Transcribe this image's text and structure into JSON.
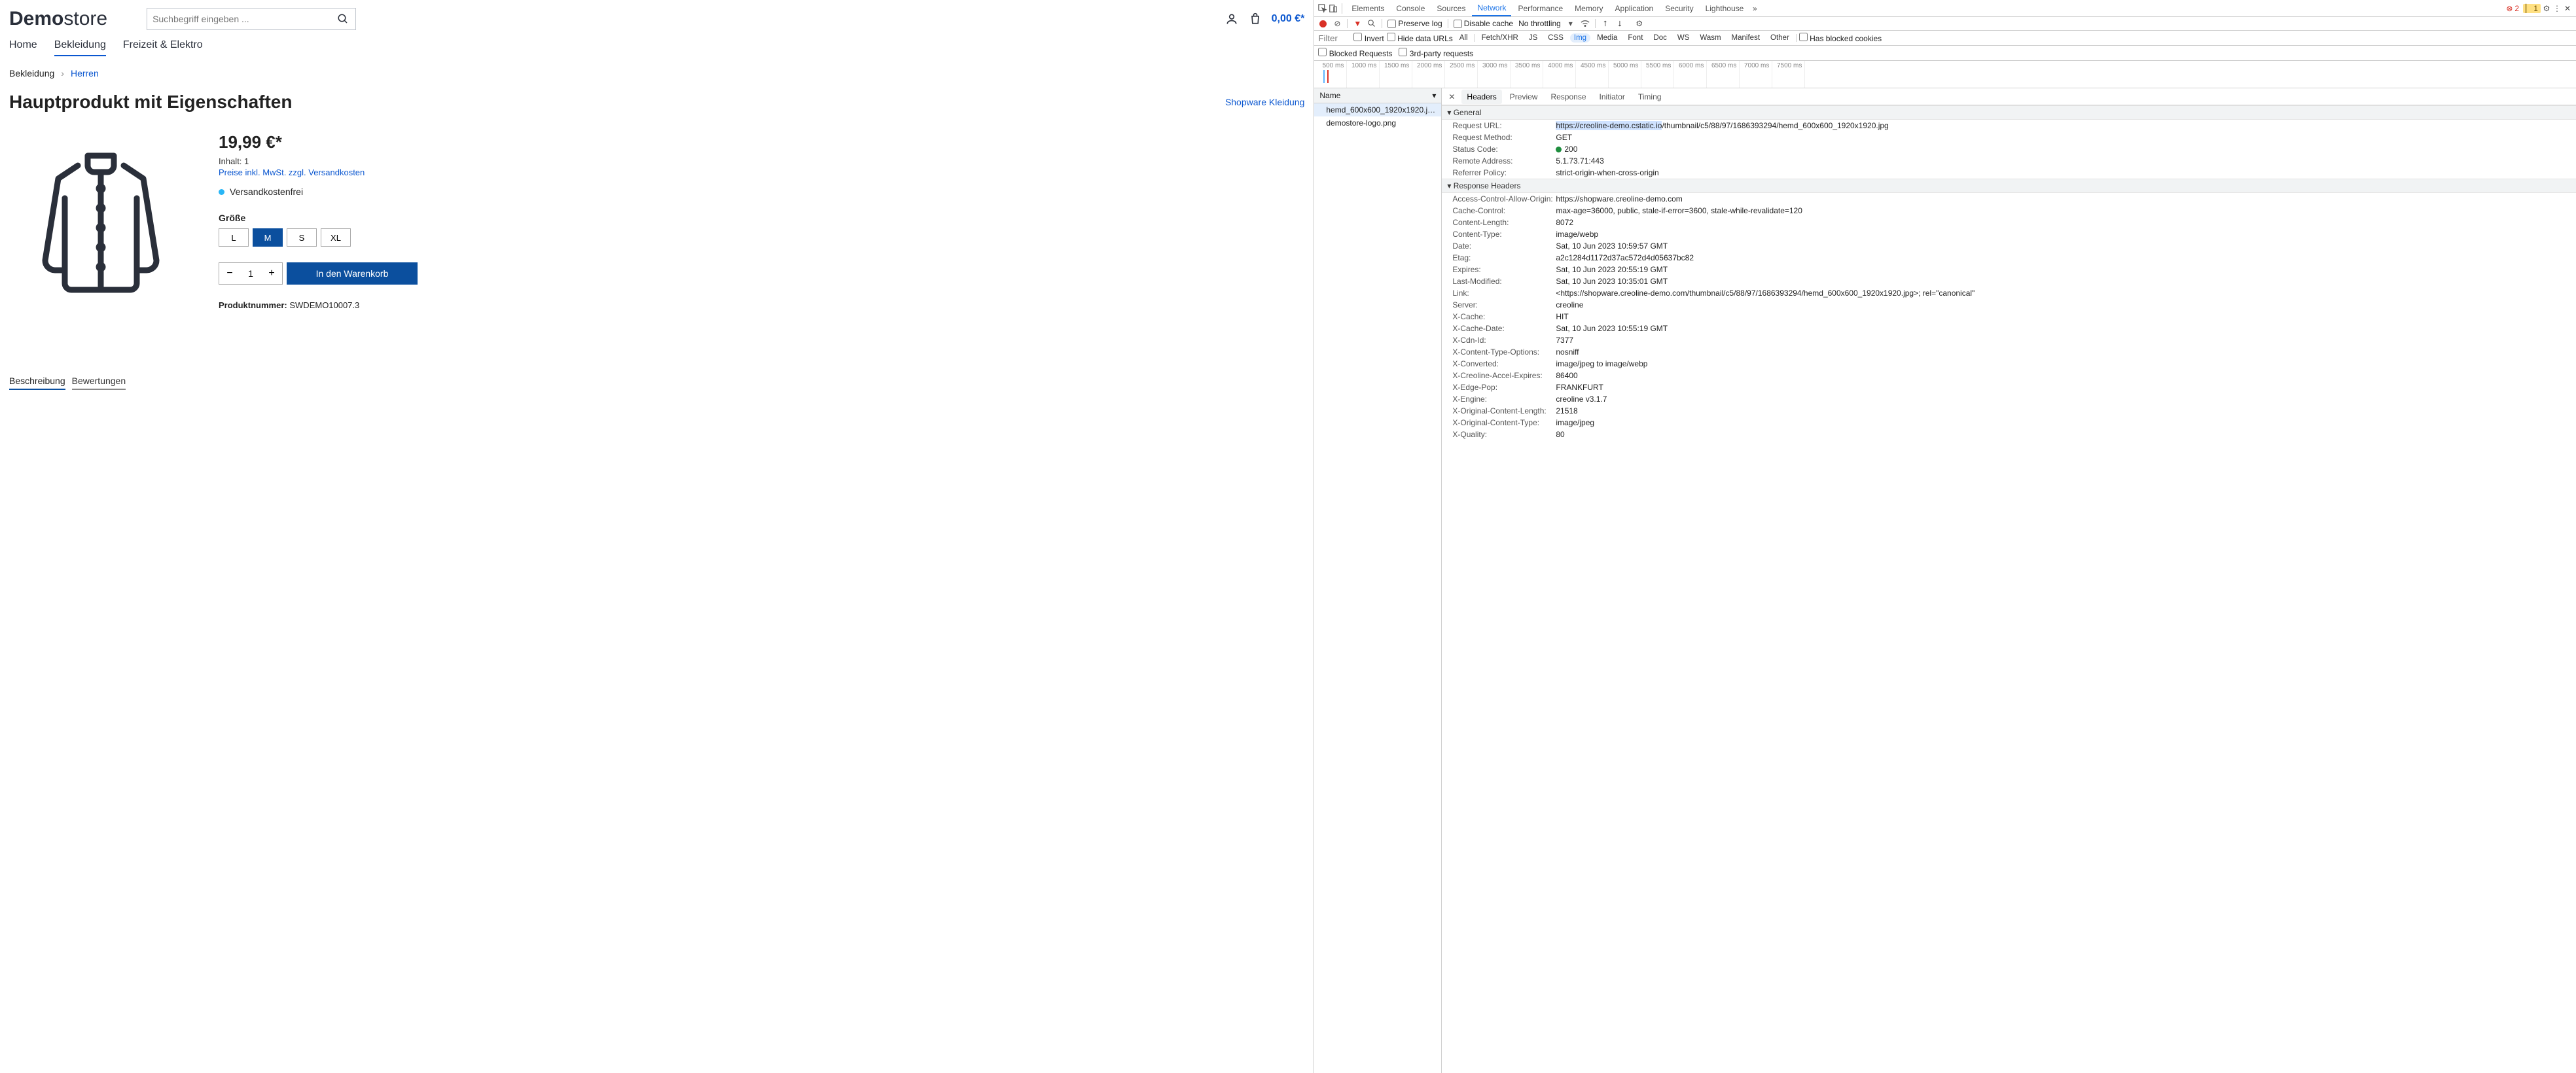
{
  "store": {
    "logo": {
      "bold": "Demo",
      "thin": "store"
    },
    "search_placeholder": "Suchbegriff eingeben ...",
    "cart_total": "0,00 €*",
    "nav": {
      "home": "Home",
      "clothing": "Bekleidung",
      "leisure": "Freizeit & Elektro"
    },
    "breadcrumb": {
      "cat": "Bekleidung",
      "sub": "Herren"
    },
    "product": {
      "title": "Hauptprodukt mit Eigenschaften",
      "brand": "Shopware Kleidung",
      "price": "19,99 €*",
      "content_label": "Inhalt:",
      "content_value": "1",
      "tax_note": "Preise inkl. MwSt. zzgl. Versandkosten",
      "free_shipping": "Versandkostenfrei",
      "size_label": "Größe",
      "sizes": [
        "L",
        "M",
        "S",
        "XL"
      ],
      "qty": "1",
      "add_to_cart": "In den Warenkorb",
      "sku_label": "Produktnummer:",
      "sku": "SWDEMO10007.3"
    },
    "tabs": {
      "desc": "Beschreibung",
      "reviews": "Bewertungen"
    }
  },
  "devtools": {
    "main_tabs": [
      "Elements",
      "Console",
      "Sources",
      "Network",
      "Performance",
      "Memory",
      "Application",
      "Security",
      "Lighthouse"
    ],
    "errors": "2",
    "warnings": "1",
    "row2": {
      "preserve_log": "Preserve log",
      "disable_cache": "Disable cache",
      "throttling": "No throttling"
    },
    "row3": {
      "filter_placeholder": "Filter",
      "invert": "Invert",
      "hide_data": "Hide data URLs",
      "chips": [
        "All",
        "Fetch/XHR",
        "JS",
        "CSS",
        "Img",
        "Media",
        "Font",
        "Doc",
        "WS",
        "Wasm",
        "Manifest",
        "Other"
      ],
      "blocked_cookies": "Has blocked cookies"
    },
    "row4": {
      "blocked_requests": "Blocked Requests",
      "third_party": "3rd-party requests"
    },
    "timeline_ticks": [
      "500 ms",
      "1000 ms",
      "1500 ms",
      "2000 ms",
      "2500 ms",
      "3000 ms",
      "3500 ms",
      "4000 ms",
      "4500 ms",
      "5000 ms",
      "5500 ms",
      "6000 ms",
      "6500 ms",
      "7000 ms",
      "7500 ms"
    ],
    "request_list": {
      "header": "Name",
      "items": [
        "hemd_600x600_1920x1920.jpg",
        "demostore-logo.png"
      ]
    },
    "detail_tabs": [
      "Headers",
      "Preview",
      "Response",
      "Initiator",
      "Timing"
    ],
    "general": {
      "title": "General",
      "request_url_label": "Request URL:",
      "request_url_host": "https://creoline-demo.cstatic.io",
      "request_url_path": "/thumbnail/c5/88/97/1686393294/hemd_600x600_1920x1920.jpg",
      "method_label": "Request Method:",
      "method": "GET",
      "status_label": "Status Code:",
      "status": "200",
      "remote_label": "Remote Address:",
      "remote": "5.1.73.71:443",
      "referrer_label": "Referrer Policy:",
      "referrer": "strict-origin-when-cross-origin"
    },
    "response_headers": {
      "title": "Response Headers",
      "rows": [
        [
          "Access-Control-Allow-Origin:",
          "https://shopware.creoline-demo.com"
        ],
        [
          "Cache-Control:",
          "max-age=36000, public, stale-if-error=3600, stale-while-revalidate=120"
        ],
        [
          "Content-Length:",
          "8072"
        ],
        [
          "Content-Type:",
          "image/webp"
        ],
        [
          "Date:",
          "Sat, 10 Jun 2023 10:59:57 GMT"
        ],
        [
          "Etag:",
          "a2c1284d1172d37ac572d4d05637bc82"
        ],
        [
          "Expires:",
          "Sat, 10 Jun 2023 20:55:19 GMT"
        ],
        [
          "Last-Modified:",
          "Sat, 10 Jun 2023 10:35:01 GMT"
        ],
        [
          "Link:",
          "<https://shopware.creoline-demo.com/thumbnail/c5/88/97/1686393294/hemd_600x600_1920x1920.jpg>; rel=\"canonical\""
        ],
        [
          "Server:",
          "creoline"
        ],
        [
          "X-Cache:",
          "HIT"
        ],
        [
          "X-Cache-Date:",
          "Sat, 10 Jun 2023 10:55:19 GMT"
        ],
        [
          "X-Cdn-Id:",
          "7377"
        ],
        [
          "X-Content-Type-Options:",
          "nosniff"
        ],
        [
          "X-Converted:",
          "image/jpeg to image/webp"
        ],
        [
          "X-Creoline-Accel-Expires:",
          "86400"
        ],
        [
          "X-Edge-Pop:",
          "FRANKFURT"
        ],
        [
          "X-Engine:",
          "creoline v3.1.7"
        ],
        [
          "X-Original-Content-Length:",
          "21518"
        ],
        [
          "X-Original-Content-Type:",
          "image/jpeg"
        ],
        [
          "X-Quality:",
          "80"
        ]
      ]
    }
  }
}
